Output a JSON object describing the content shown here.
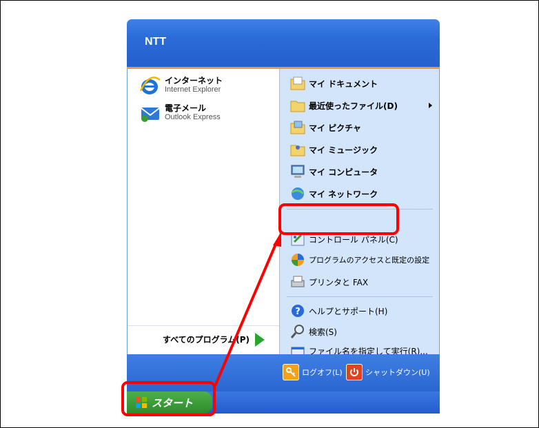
{
  "user_name": "NTT",
  "pinned": [
    {
      "title": "インターネット",
      "subtitle": "Internet Explorer",
      "icon": "internet-explorer-icon"
    },
    {
      "title": "電子メール",
      "subtitle": "Outlook Express",
      "icon": "outlook-express-icon"
    }
  ],
  "all_programs": "すべてのプログラム(P)",
  "right_items": [
    {
      "label": "マイ ドキュメント",
      "icon": "my-documents-icon"
    },
    {
      "label": "最近使ったファイル(D)",
      "icon": "recent-files-icon",
      "submenu": true
    },
    {
      "label": "マイ ピクチャ",
      "icon": "my-pictures-icon"
    },
    {
      "label": "マイ ミュージック",
      "icon": "my-music-icon"
    },
    {
      "label": "マイ コンピュータ",
      "icon": "my-computer-icon"
    },
    {
      "label": "マイ ネットワーク",
      "icon": "my-network-icon"
    },
    {
      "label": "コントロール パネル(C)",
      "icon": "control-panel-icon"
    },
    {
      "label": "プログラムのアクセスと既定の設定",
      "icon": "program-access-icon"
    },
    {
      "label": "プリンタと FAX",
      "icon": "printer-fax-icon"
    },
    {
      "label": "ヘルプとサポート(H)",
      "icon": "help-icon"
    },
    {
      "label": "検索(S)",
      "icon": "search-icon"
    },
    {
      "label": "ファイル名を指定して実行(R)...",
      "icon": "run-icon"
    }
  ],
  "footer": {
    "logoff": "ログオフ(L)",
    "shutdown": "シャットダウン(U)"
  },
  "start_label": "スタート",
  "colors": {
    "highlight": "#ff0000",
    "header": "#2a6bd8",
    "right_pane": "#d3e5fa",
    "start": "#3a9a37"
  }
}
